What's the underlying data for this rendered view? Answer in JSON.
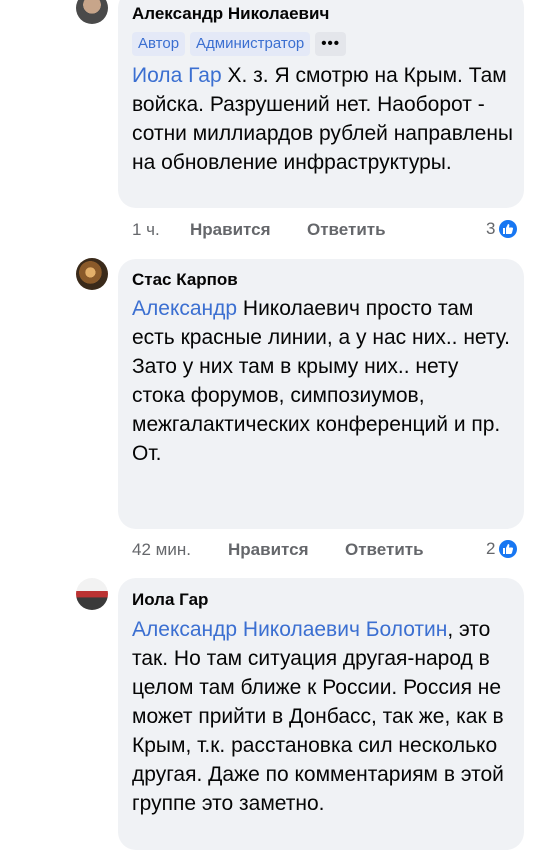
{
  "comments": [
    {
      "author": "Александр Николаевич",
      "badges": [
        "Автор",
        "Администратор",
        "•••"
      ],
      "mention": "Иола Гар",
      "text_after_mention": " Х. з. Я смотрю на Крым. Там войска. Разрушений нет. Наоборот - сотни миллиардов рублей направлены на обновление инфраструктуры.",
      "time": "1 ч.",
      "like_label": "Нравится",
      "reply_label": "Ответить",
      "reaction_count": "3"
    },
    {
      "author": "Стас Карпов",
      "mention": "Александр",
      "text_after_mention": " Николаевич просто там есть красные линии, а у нас них.. нету.",
      "text_line2": "Зато у них там в крыму них.. нету стока форумов, симпозиумов, межгалактических конференций и пр.",
      "text_line3": "От.",
      "time": "42 мин.",
      "like_label": "Нравится",
      "reply_label": "Ответить",
      "reaction_count": "2"
    },
    {
      "author": "Иола Гар",
      "mention": "Александр Николаевич Болотин",
      "text_after_mention": ", это так. Но там ситуация другая-народ в целом там ближе к России. Россия не может прийти в Донбасс, так же, как в Крым, т.к. расстановка сил несколько другая. Даже по комментариям в этой группе это заметно."
    }
  ],
  "colors": {
    "bubble": "#f0f2f5",
    "mention": "#3b6fd1",
    "meta": "#65676b",
    "like_badge": "#1877f2"
  }
}
